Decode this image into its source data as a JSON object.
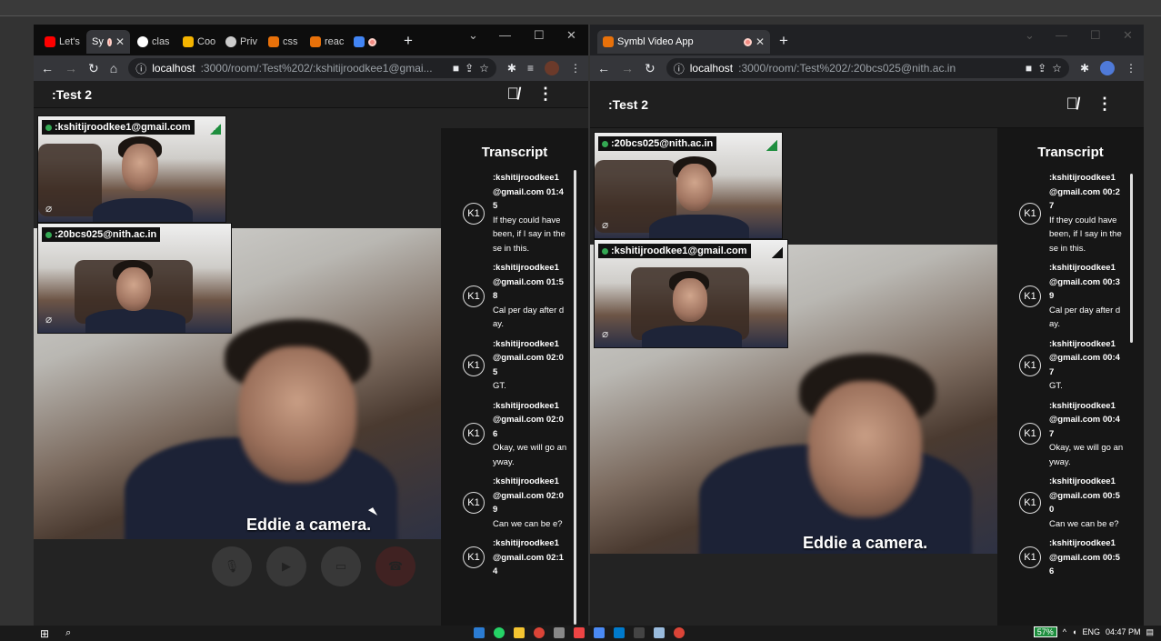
{
  "left_window": {
    "tabs": [
      {
        "label": "Let's",
        "color": "#ff0000"
      },
      {
        "label": "Sy",
        "color": "#f28b82",
        "active": true
      },
      {
        "label": "clas",
        "color": "#ffffff"
      },
      {
        "label": "Coo",
        "color": "#f4b400"
      },
      {
        "label": "Priv",
        "color": "#cccccc"
      },
      {
        "label": "css",
        "color": "#e8710a"
      },
      {
        "label": "reac",
        "color": "#e8710a"
      },
      {
        "label": "",
        "color": "#4285f4"
      }
    ],
    "url_host": "localhost",
    "url_path": ":3000/room/:Test%202/:kshitijroodkee1@gmai...",
    "room_title": ":Test 2",
    "tiles": [
      {
        "label": ":kshitijroodkee1@gmail.com"
      },
      {
        "label": ":20bcs025@nith.ac.in"
      }
    ],
    "caption": "Eddie a camera.",
    "transcript_title": "Transcript",
    "entries": [
      {
        "avatar": "K1",
        "speaker": ":kshitijroodkee1@gmail.com",
        "time": "01:45",
        "text": "If they could have been, if I say in these in this."
      },
      {
        "avatar": "K1",
        "speaker": ":kshitijroodkee1@gmail.com",
        "time": "01:58",
        "text": "Cal per day after day."
      },
      {
        "avatar": "K1",
        "speaker": ":kshitijroodkee1@gmail.com",
        "time": "02:05",
        "text": "GT."
      },
      {
        "avatar": "K1",
        "speaker": ":kshitijroodkee1@gmail.com",
        "time": "02:06",
        "text": "Okay, we will go anyway."
      },
      {
        "avatar": "K1",
        "speaker": ":kshitijroodkee1@gmail.com",
        "time": "02:09",
        "text": "Can we can be e?"
      },
      {
        "avatar": "K1",
        "speaker": ":kshitijroodkee1@gmail.com",
        "time": "02:14",
        "text": ""
      }
    ]
  },
  "right_window": {
    "tab_label": "Symbl Video App",
    "url_host": "localhost",
    "url_path": ":3000/room/:Test%202/:20bcs025@nith.ac.in",
    "room_title": ":Test 2",
    "tiles": [
      {
        "label": ":20bcs025@nith.ac.in"
      },
      {
        "label": ":kshitijroodkee1@gmail.com"
      }
    ],
    "caption": "Eddie a camera.",
    "transcript_title": "Transcript",
    "entries": [
      {
        "avatar": "K1",
        "speaker": ":kshitijroodkee1@gmail.com",
        "time": "00:27",
        "text": "If they could have been, if I say in these in this."
      },
      {
        "avatar": "K1",
        "speaker": ":kshitijroodkee1@gmail.com",
        "time": "00:39",
        "text": "Cal per day after day."
      },
      {
        "avatar": "K1",
        "speaker": ":kshitijroodkee1@gmail.com",
        "time": "00:47",
        "text": "GT."
      },
      {
        "avatar": "K1",
        "speaker": ":kshitijroodkee1@gmail.com",
        "time": "00:47",
        "text": "Okay, we will go anyway."
      },
      {
        "avatar": "K1",
        "speaker": ":kshitijroodkee1@gmail.com",
        "time": "00:50",
        "text": "Can we can be e?"
      },
      {
        "avatar": "K1",
        "speaker": ":kshitijroodkee1@gmail.com",
        "time": "00:56",
        "text": ""
      }
    ]
  },
  "taskbar": {
    "battery": "57%",
    "language": "ENG",
    "time": "04:47 PM"
  }
}
